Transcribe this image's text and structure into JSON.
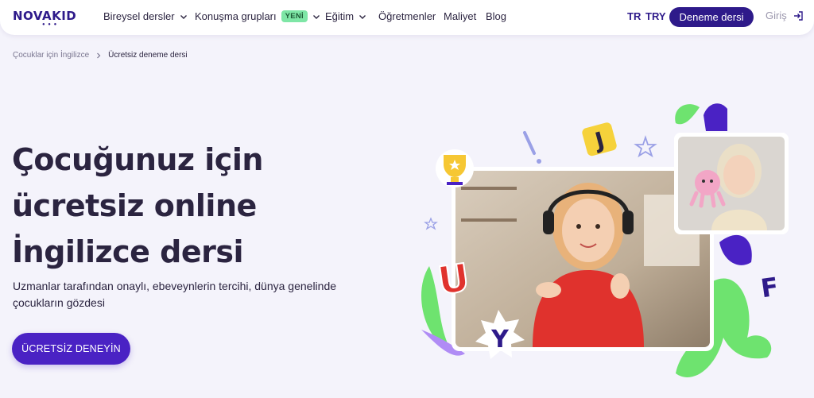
{
  "header": {
    "logo": "NOVAKID",
    "nav": [
      {
        "label": "Bireysel dersler",
        "has_dropdown": true
      },
      {
        "label": "Konuşma grupları",
        "has_dropdown": true,
        "badge": "YENİ"
      },
      {
        "label": "Eğitim",
        "has_dropdown": true
      },
      {
        "label": "Öğretmenler"
      },
      {
        "label": "Maliyet"
      },
      {
        "label": "Blog"
      }
    ],
    "language": "TR",
    "currency": "TRY",
    "trial_button": "Deneme dersi",
    "login": "Giriş"
  },
  "breadcrumb": {
    "parent": "Çocuklar için İngilizce",
    "current": "Ücretsiz deneme dersi"
  },
  "hero": {
    "title_lines": [
      "Çocuğunuz için",
      "ücretsiz online",
      "İngilizce dersi"
    ],
    "subtitle_lines": [
      "Uzmanlar tarafından onaylı, ebeveynlerin tercihi, dünya genelinde",
      "çocukların gözdesi"
    ],
    "cta": "ÜCRETSİZ DENEYİN"
  },
  "illustration": {
    "letters": [
      "J",
      "U",
      "Y",
      "F"
    ]
  },
  "colors": {
    "brand": "#2e1a8a",
    "cta": "#4a22c4",
    "background": "#f4f3fb",
    "badge": "#7ee6a6",
    "accent_green": "#6ee36f",
    "accent_purple": "#7b4cf0"
  }
}
